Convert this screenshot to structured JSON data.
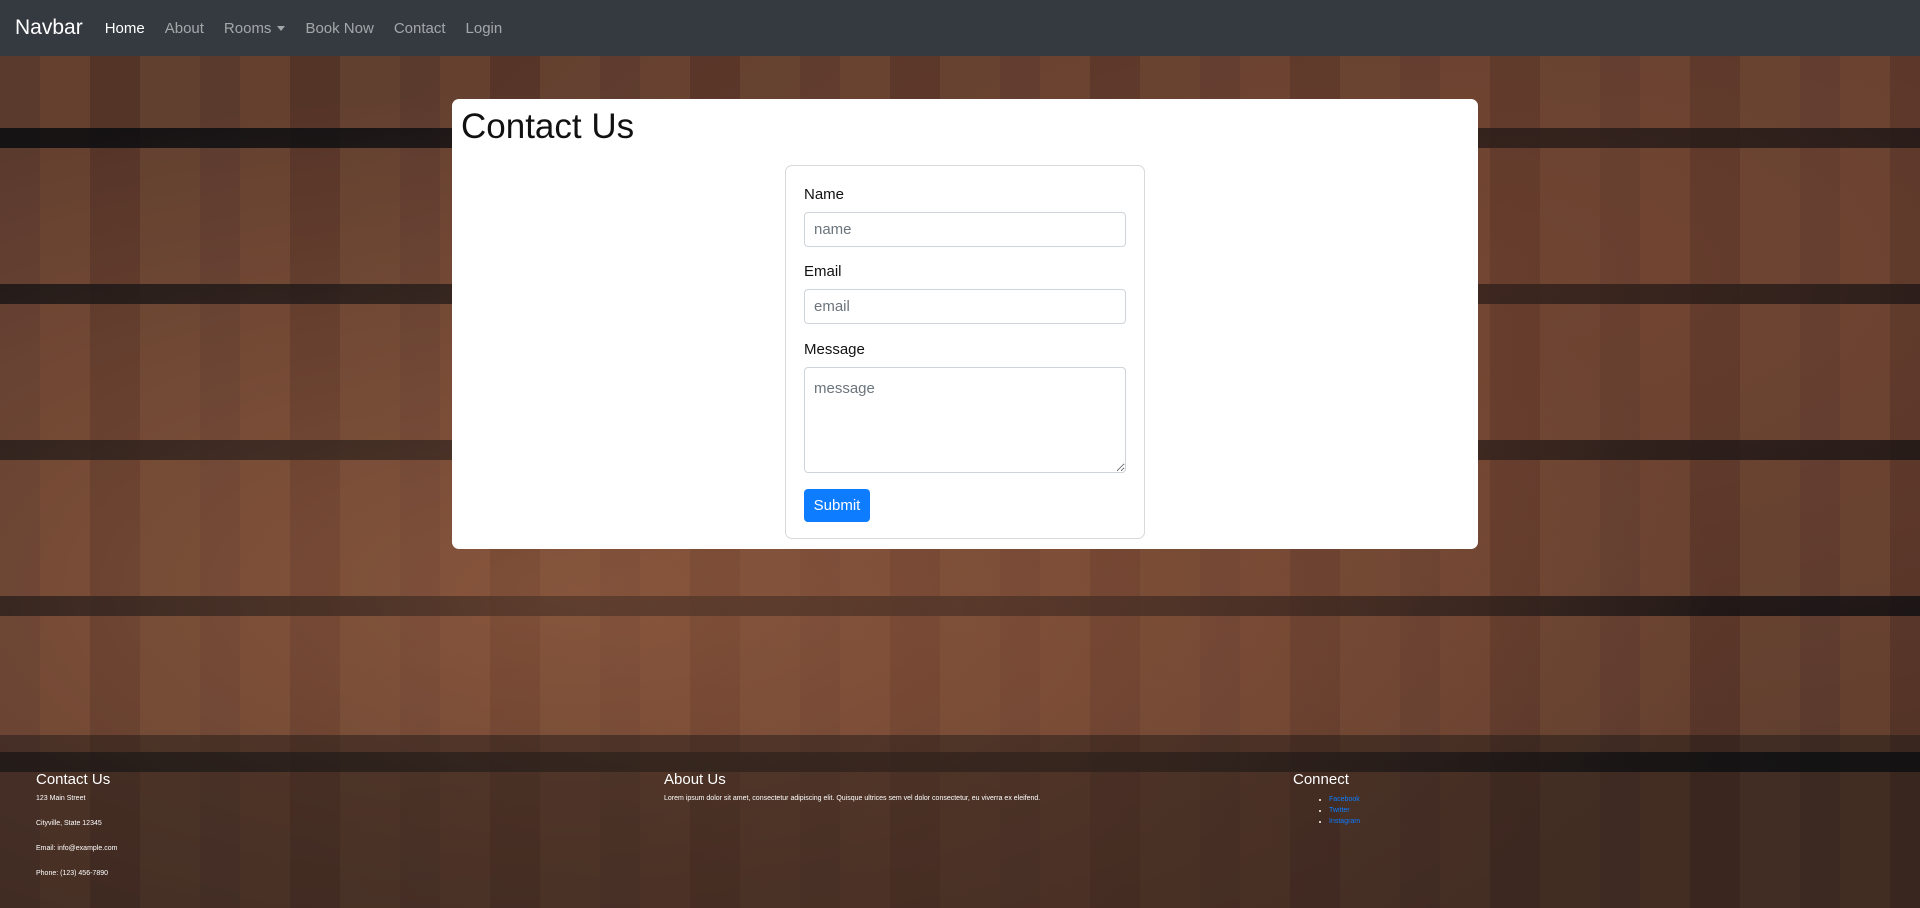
{
  "navbar": {
    "brand": "Navbar",
    "links": [
      "Home",
      "About",
      "Rooms",
      "Book Now",
      "Contact",
      "Login"
    ]
  },
  "main": {
    "title": "Contact Us",
    "form": {
      "name_label": "Name",
      "name_placeholder": "name",
      "email_label": "Email",
      "email_placeholder": "email",
      "message_label": "Message",
      "message_placeholder": "message",
      "submit_label": "Submit"
    }
  },
  "footer": {
    "contact": {
      "heading": "Contact Us",
      "lines": [
        "123 Main Street",
        "Cityville, State 12345",
        "Email: info@example.com",
        "Phone: (123) 456-7890"
      ]
    },
    "about": {
      "heading": "About Us",
      "text": "Lorem ipsum dolor sit amet, consectetur adipiscing elit. Quisque ultrices sem vel dolor consectetur, eu viverra ex eleifend."
    },
    "connect": {
      "heading": "Connect",
      "links": [
        "Facebook",
        "Twitter",
        "Instagram"
      ]
    }
  },
  "colors": {
    "navbar_bg": "#343a40",
    "primary": "#0d7cff"
  }
}
